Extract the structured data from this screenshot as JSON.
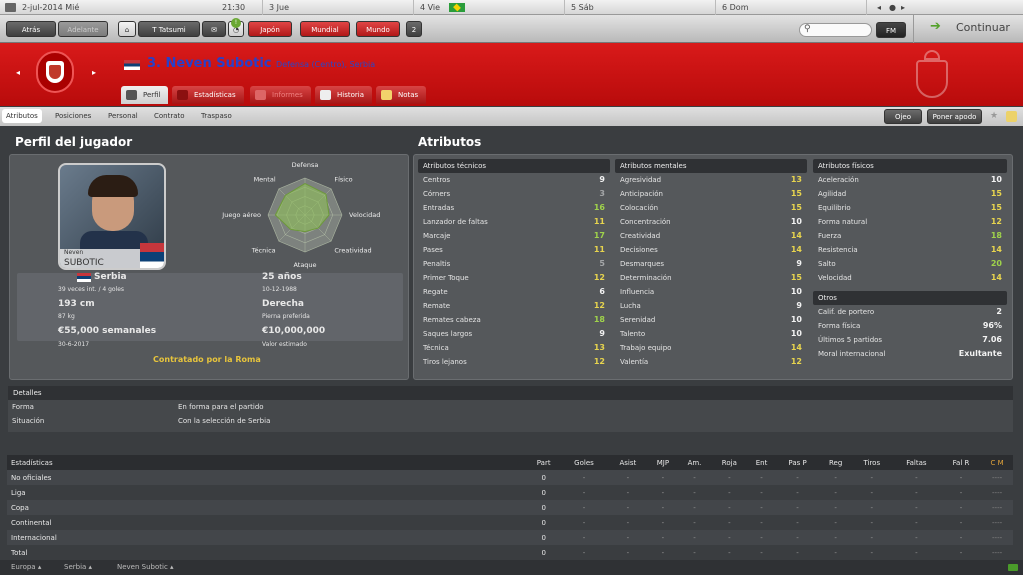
{
  "calendar": {
    "date": "2-jul-2014 Mié",
    "time": "21:30",
    "days": [
      "3 Jue",
      "4 Vie",
      "5 Sáb",
      "6 Dom"
    ]
  },
  "topbar": {
    "back": "Atrás",
    "forward": "Adelante",
    "manager": "T Tatsumi",
    "menus": [
      "Japón",
      "Mundial",
      "Mundo"
    ],
    "badge": "2",
    "continue": "Continuar",
    "fm": "FM"
  },
  "player": {
    "number": "3.",
    "name": "Neven Subotic",
    "position": "Defensa (Centro), Serbia"
  },
  "tabs": [
    "Perfil",
    "Estadísticas",
    "Informes",
    "Historia",
    "Notas"
  ],
  "subnav": {
    "items": [
      "Atributos",
      "Posiciones",
      "Personal",
      "Contrato",
      "Traspaso"
    ],
    "scout": "Ojeo",
    "nickname": "Poner apodo"
  },
  "profile": {
    "title": "Perfil del jugador",
    "card_first": "Neven",
    "card_last": "SUBOTIC",
    "nation": "Serbia",
    "caps": "39 veces int. / 4 goles",
    "age": "25 años",
    "dob": "10-12-1988",
    "height": "193 cm",
    "weight": "87 kg",
    "foot": "Derecha",
    "foot_lbl": "Pierna preferida",
    "wage": "€55,000 semanales",
    "expires": "30-6-2017",
    "value": "€10,000,000",
    "value_lbl": "Valor estimado",
    "loan": "Contratado por la Roma"
  },
  "radar": {
    "labels": [
      "Defensa",
      "Físico",
      "Velocidad",
      "Creatividad",
      "Ataque",
      "Técnica",
      "Juego aéreo",
      "Mental"
    ],
    "values": [
      0.85,
      0.8,
      0.65,
      0.5,
      0.45,
      0.55,
      0.8,
      0.75
    ]
  },
  "attributes": {
    "title": "Atributos",
    "technical": {
      "title": "Atributos técnicos",
      "rows": [
        [
          "Centros",
          "9"
        ],
        [
          "Córners",
          "3"
        ],
        [
          "Entradas",
          "16"
        ],
        [
          "Lanzador de faltas",
          "11"
        ],
        [
          "Marcaje",
          "17"
        ],
        [
          "Pases",
          "11"
        ],
        [
          "Penaltis",
          "5"
        ],
        [
          "Primer Toque",
          "12"
        ],
        [
          "Regate",
          "6"
        ],
        [
          "Remate",
          "12"
        ],
        [
          "Remates cabeza",
          "18"
        ],
        [
          "Saques largos",
          "9"
        ],
        [
          "Técnica",
          "13"
        ],
        [
          "Tiros lejanos",
          "12"
        ]
      ]
    },
    "mental": {
      "title": "Atributos mentales",
      "rows": [
        [
          "Agresividad",
          "13"
        ],
        [
          "Anticipación",
          "15"
        ],
        [
          "Colocación",
          "15"
        ],
        [
          "Concentración",
          "10"
        ],
        [
          "Creatividad",
          "14"
        ],
        [
          "Decisiones",
          "14"
        ],
        [
          "Desmarques",
          "9"
        ],
        [
          "Determinación",
          "15"
        ],
        [
          "Influencia",
          "10"
        ],
        [
          "Lucha",
          "9"
        ],
        [
          "Serenidad",
          "10"
        ],
        [
          "Talento",
          "10"
        ],
        [
          "Trabajo equipo",
          "14"
        ],
        [
          "Valentía",
          "12"
        ]
      ]
    },
    "physical": {
      "title": "Atributos físicos",
      "rows": [
        [
          "Aceleración",
          "10"
        ],
        [
          "Agilidad",
          "15"
        ],
        [
          "Equilibrio",
          "15"
        ],
        [
          "Forma natural",
          "12"
        ],
        [
          "Fuerza",
          "18"
        ],
        [
          "Resistencia",
          "14"
        ],
        [
          "Salto",
          "20"
        ],
        [
          "Velocidad",
          "14"
        ]
      ]
    },
    "others": {
      "title": "Otros",
      "rows": [
        [
          "Calif. de portero",
          "2"
        ],
        [
          "Forma física",
          "96%"
        ],
        [
          "Últimos 5 partidos",
          "7.06"
        ],
        [
          "Moral internacional",
          "Exultante"
        ]
      ]
    }
  },
  "details": {
    "title": "Detalles",
    "rows": [
      [
        "Forma",
        "En forma para el partido"
      ],
      [
        "Situación",
        "Con la selección de Serbia"
      ]
    ]
  },
  "stats": {
    "title": "Estadísticas",
    "cols": [
      "Part",
      "Goles",
      "Asist",
      "MJP",
      "Am.",
      "Roja",
      "Ent",
      "Pas P",
      "Reg",
      "Tiros",
      "Faltas",
      "Fal R",
      "C M"
    ],
    "rows": [
      [
        "No oficiales",
        "0"
      ],
      [
        "Liga",
        "0"
      ],
      [
        "Copa",
        "0"
      ],
      [
        "Continental",
        "0"
      ],
      [
        "Internacional",
        "0"
      ],
      [
        "Total",
        "0"
      ]
    ],
    "dash": "-",
    "cm": "----"
  },
  "footer": [
    "Europa",
    "Serbia",
    "Neven Subotic"
  ],
  "colors": {
    "red": "#c81414",
    "green": "#9fd24b",
    "yellow": "#e7d44e"
  }
}
